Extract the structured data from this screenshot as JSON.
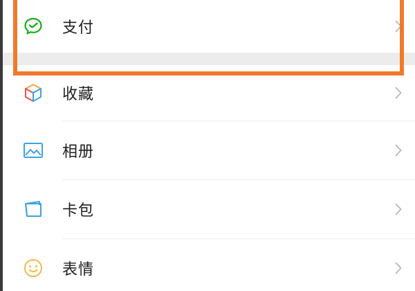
{
  "menu": {
    "items": [
      {
        "id": "pay",
        "label": "支付",
        "icon": "wechat-pay-icon",
        "icon_color": "#1aad19"
      },
      {
        "id": "favorites",
        "label": "收藏",
        "icon": "favorites-cube-icon",
        "icon_color": "#f2a63a"
      },
      {
        "id": "album",
        "label": "相册",
        "icon": "album-picture-icon",
        "icon_color": "#3ea2e4"
      },
      {
        "id": "cards",
        "label": "卡包",
        "icon": "card-wallet-icon",
        "icon_color": "#3ea2e4"
      },
      {
        "id": "stickers",
        "label": "表情",
        "icon": "sticker-smile-icon",
        "icon_color": "#f2b84b"
      }
    ]
  },
  "colors": {
    "highlight": "#f07a2c",
    "separator": "#ececec",
    "chevron": "#b8b8b8"
  }
}
